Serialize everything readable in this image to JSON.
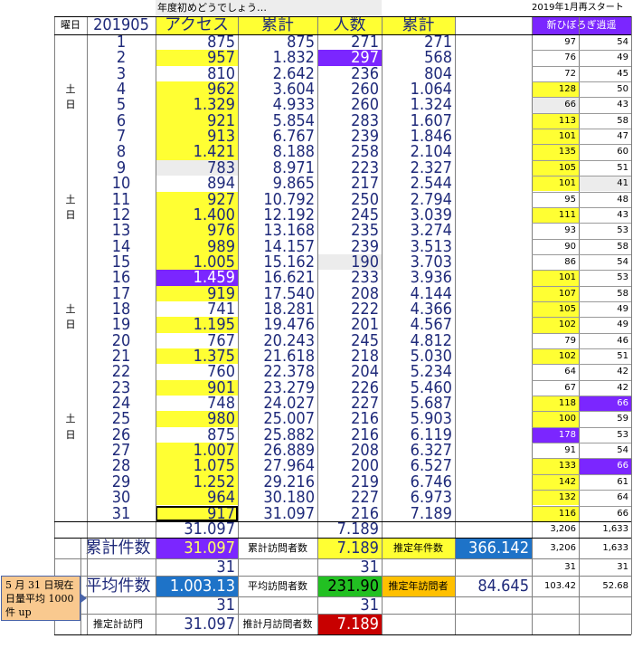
{
  "colors": {
    "yellow": "#ffff33",
    "purple": "#7b26ff",
    "lightgray": "#ececec",
    "navy": "#1f2a7a",
    "blue_cell": "#1e73c8",
    "green_cell": "#22c022",
    "red_cell": "#c80000",
    "black": "#000000",
    "ochre": "#ffc000"
  },
  "header": {
    "banner": "年度初めどうでしょう…",
    "right_banner": "2019年1月再スタート",
    "right_sub": "新ひぼろぎ逍遥",
    "col_weekday": "曜日",
    "col_month": "201905",
    "col_access": "アクセス",
    "col_cum1": "累計",
    "col_people": "人数",
    "col_cum2": "累計"
  },
  "rows": [
    {
      "wd": "",
      "day": "1",
      "acc": "875",
      "cum": "875",
      "ppl": "271",
      "cum2": "271",
      "ra": "97",
      "rb": "54"
    },
    {
      "wd": "",
      "day": "2",
      "acc": "957",
      "cum": "1.832",
      "ppl": "297",
      "cum2": "568",
      "ra": "76",
      "rb": "49"
    },
    {
      "wd": "",
      "day": "3",
      "acc": "810",
      "cum": "2.642",
      "ppl": "236",
      "cum2": "804",
      "ra": "72",
      "rb": "45"
    },
    {
      "wd": "土",
      "day": "4",
      "acc": "962",
      "cum": "3.604",
      "ppl": "260",
      "cum2": "1.064",
      "ra": "128",
      "rb": "50"
    },
    {
      "wd": "日",
      "day": "5",
      "acc": "1.329",
      "cum": "4.933",
      "ppl": "260",
      "cum2": "1.324",
      "ra": "66",
      "rb": "43"
    },
    {
      "wd": "",
      "day": "6",
      "acc": "921",
      "cum": "5.854",
      "ppl": "283",
      "cum2": "1.607",
      "ra": "113",
      "rb": "58"
    },
    {
      "wd": "",
      "day": "7",
      "acc": "913",
      "cum": "6.767",
      "ppl": "239",
      "cum2": "1.846",
      "ra": "101",
      "rb": "47"
    },
    {
      "wd": "",
      "day": "8",
      "acc": "1.421",
      "cum": "8.188",
      "ppl": "258",
      "cum2": "2.104",
      "ra": "135",
      "rb": "60"
    },
    {
      "wd": "",
      "day": "9",
      "acc": "783",
      "cum": "8.971",
      "ppl": "223",
      "cum2": "2.327",
      "ra": "105",
      "rb": "51"
    },
    {
      "wd": "",
      "day": "10",
      "acc": "894",
      "cum": "9.865",
      "ppl": "217",
      "cum2": "2.544",
      "ra": "101",
      "rb": "41"
    },
    {
      "wd": "土",
      "day": "11",
      "acc": "927",
      "cum": "10.792",
      "ppl": "250",
      "cum2": "2.794",
      "ra": "95",
      "rb": "48"
    },
    {
      "wd": "日",
      "day": "12",
      "acc": "1.400",
      "cum": "12.192",
      "ppl": "245",
      "cum2": "3.039",
      "ra": "111",
      "rb": "43"
    },
    {
      "wd": "",
      "day": "13",
      "acc": "976",
      "cum": "13.168",
      "ppl": "235",
      "cum2": "3.274",
      "ra": "93",
      "rb": "53"
    },
    {
      "wd": "",
      "day": "14",
      "acc": "989",
      "cum": "14.157",
      "ppl": "239",
      "cum2": "3.513",
      "ra": "90",
      "rb": "58"
    },
    {
      "wd": "",
      "day": "15",
      "acc": "1.005",
      "cum": "15.162",
      "ppl": "190",
      "cum2": "3.703",
      "ra": "86",
      "rb": "54"
    },
    {
      "wd": "",
      "day": "16",
      "acc": "1.459",
      "cum": "16.621",
      "ppl": "233",
      "cum2": "3.936",
      "ra": "101",
      "rb": "53"
    },
    {
      "wd": "",
      "day": "17",
      "acc": "919",
      "cum": "17.540",
      "ppl": "208",
      "cum2": "4.144",
      "ra": "107",
      "rb": "58"
    },
    {
      "wd": "土",
      "day": "18",
      "acc": "741",
      "cum": "18.281",
      "ppl": "222",
      "cum2": "4.366",
      "ra": "105",
      "rb": "49"
    },
    {
      "wd": "日",
      "day": "19",
      "acc": "1.195",
      "cum": "19.476",
      "ppl": "201",
      "cum2": "4.567",
      "ra": "102",
      "rb": "49"
    },
    {
      "wd": "",
      "day": "20",
      "acc": "767",
      "cum": "20.243",
      "ppl": "245",
      "cum2": "4.812",
      "ra": "79",
      "rb": "46"
    },
    {
      "wd": "",
      "day": "21",
      "acc": "1.375",
      "cum": "21.618",
      "ppl": "218",
      "cum2": "5.030",
      "ra": "102",
      "rb": "51"
    },
    {
      "wd": "",
      "day": "22",
      "acc": "760",
      "cum": "22.378",
      "ppl": "204",
      "cum2": "5.234",
      "ra": "64",
      "rb": "42"
    },
    {
      "wd": "",
      "day": "23",
      "acc": "901",
      "cum": "23.279",
      "ppl": "226",
      "cum2": "5.460",
      "ra": "67",
      "rb": "42"
    },
    {
      "wd": "",
      "day": "24",
      "acc": "748",
      "cum": "24.027",
      "ppl": "227",
      "cum2": "5.687",
      "ra": "118",
      "rb": "66"
    },
    {
      "wd": "土",
      "day": "25",
      "acc": "980",
      "cum": "25.007",
      "ppl": "216",
      "cum2": "5.903",
      "ra": "100",
      "rb": "59"
    },
    {
      "wd": "日",
      "day": "26",
      "acc": "875",
      "cum": "25.882",
      "ppl": "216",
      "cum2": "6.119",
      "ra": "178",
      "rb": "53"
    },
    {
      "wd": "",
      "day": "27",
      "acc": "1.007",
      "cum": "26.889",
      "ppl": "208",
      "cum2": "6.327",
      "ra": "91",
      "rb": "54"
    },
    {
      "wd": "",
      "day": "28",
      "acc": "1.075",
      "cum": "27.964",
      "ppl": "200",
      "cum2": "6.527",
      "ra": "133",
      "rb": "66"
    },
    {
      "wd": "",
      "day": "29",
      "acc": "1.252",
      "cum": "29.216",
      "ppl": "219",
      "cum2": "6.746",
      "ra": "142",
      "rb": "61"
    },
    {
      "wd": "",
      "day": "30",
      "acc": "964",
      "cum": "30.180",
      "ppl": "227",
      "cum2": "6.973",
      "ra": "132",
      "rb": "64"
    },
    {
      "wd": "",
      "day": "31",
      "acc": "917",
      "cum": "31.097",
      "ppl": "216",
      "cum2": "7.189",
      "ra": "116",
      "rb": "66"
    }
  ],
  "summary": {
    "r1": {
      "acc": "31.097",
      "ppl": "7.189",
      "ra": "3,206",
      "rb": "1,633"
    },
    "r2": {
      "label": "累計件数",
      "acc": "31.097",
      "lab2": "累計訪問者数",
      "ppl": "7.189",
      "lab3": "推定年件数",
      "val3": "366.142",
      "ra": "3,206",
      "rb": "1,633"
    },
    "r3": {
      "acc": "31",
      "ppl": "31",
      "ra": "31",
      "rb": "31"
    },
    "r4": {
      "label": "平均件数",
      "acc": "1.003.13",
      "lab2": "平均訪問者数",
      "ppl": "231.90",
      "lab3": "推定年訪問者",
      "val3": "84.645",
      "ra": "103.42",
      "rb": "52.68"
    },
    "r5": {
      "acc": "31",
      "ppl": "31"
    },
    "r6": {
      "label": "推定計訪門",
      "acc": "31.097",
      "lab2": "推計月訪問者数",
      "ppl": "7.189"
    }
  },
  "callout": "5 月 31 日現在日量平均 1000 件 up"
}
